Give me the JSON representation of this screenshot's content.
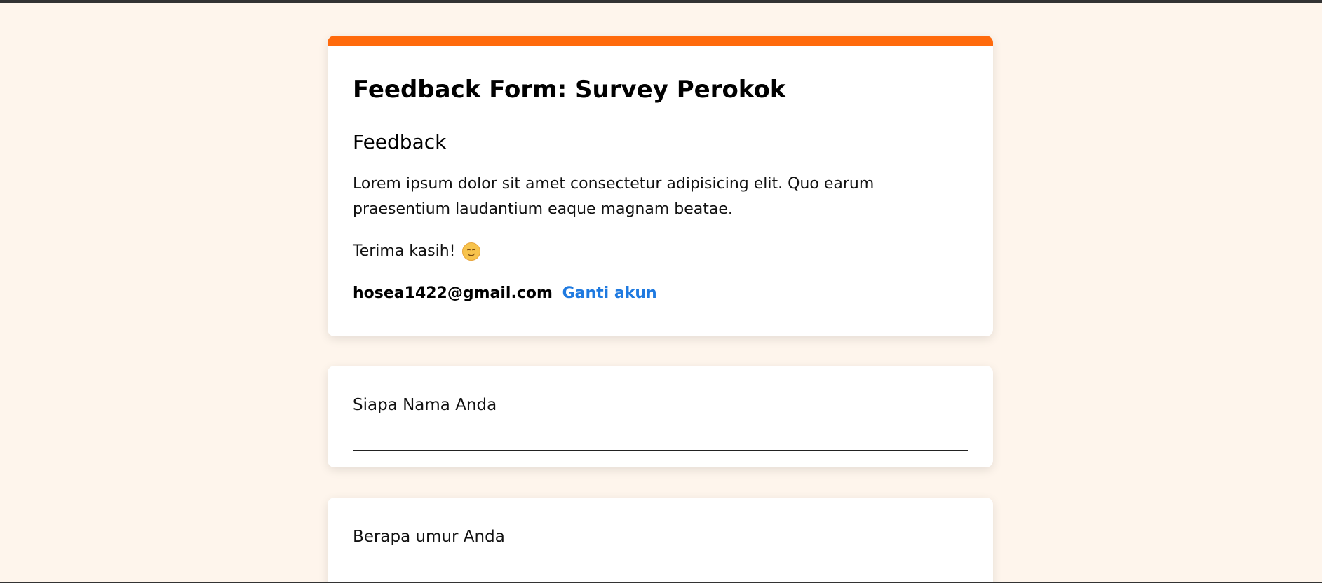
{
  "form": {
    "title": "Feedback Form: Survey Perokok",
    "section_title": "Feedback",
    "description": "Lorem ipsum dolor sit amet consectetur adipisicing elit. Quo earum praesentium laudantium eaque magnam beatae.",
    "thanks_text": "Terima kasih!",
    "thanks_icon": "smiling-face-icon",
    "account_email": "hosea1422@gmail.com",
    "switch_account_label": "Ganti akun",
    "accent_color": "#ff6a0c",
    "link_color": "#1f7ae0",
    "background_color": "#fef5ec"
  },
  "questions": [
    {
      "label": "Siapa Nama Anda",
      "value": "",
      "placeholder": ""
    },
    {
      "label": "Berapa umur Anda",
      "value": "",
      "placeholder": ""
    }
  ]
}
